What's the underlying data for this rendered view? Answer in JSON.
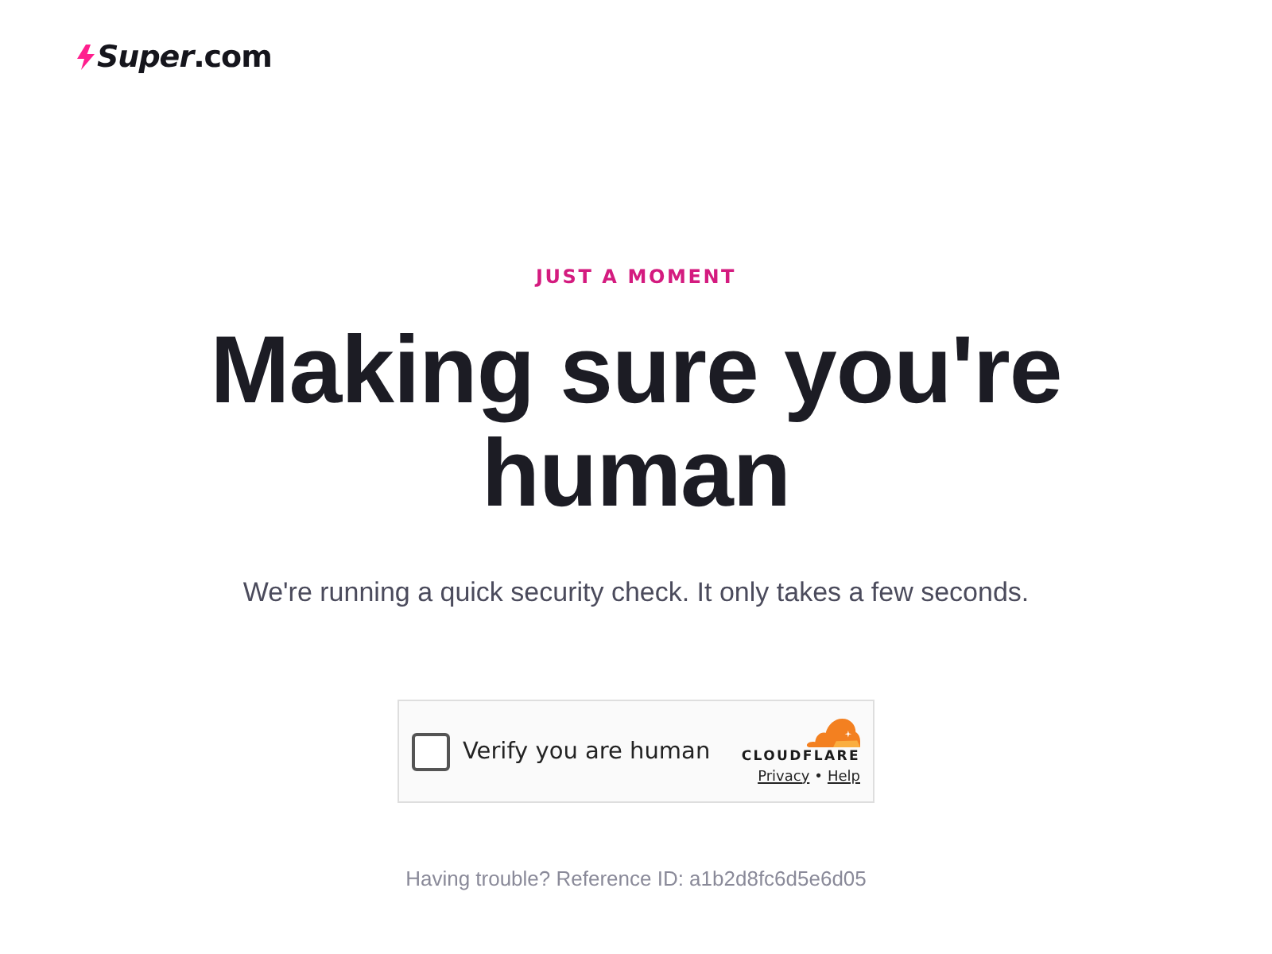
{
  "header": {
    "logo": {
      "text": "*Super*.com"
    }
  },
  "main": {
    "eyebrow": "JUST A MOMENT",
    "heading": "Making sure you're human",
    "subtitle": "We're running a quick security check. It only takes a few seconds.",
    "widget": {
      "checkbox": {
        "label": "Verify you are human",
        "checked": false
      },
      "provider": {
        "name": "CLOUDFLARE",
        "links": [
          "Privacy",
          "Help"
        ],
        "separator": "•"
      }
    },
    "footer": "Having trouble? Reference ID: a1b2d8fc6d5e6d05"
  }
}
